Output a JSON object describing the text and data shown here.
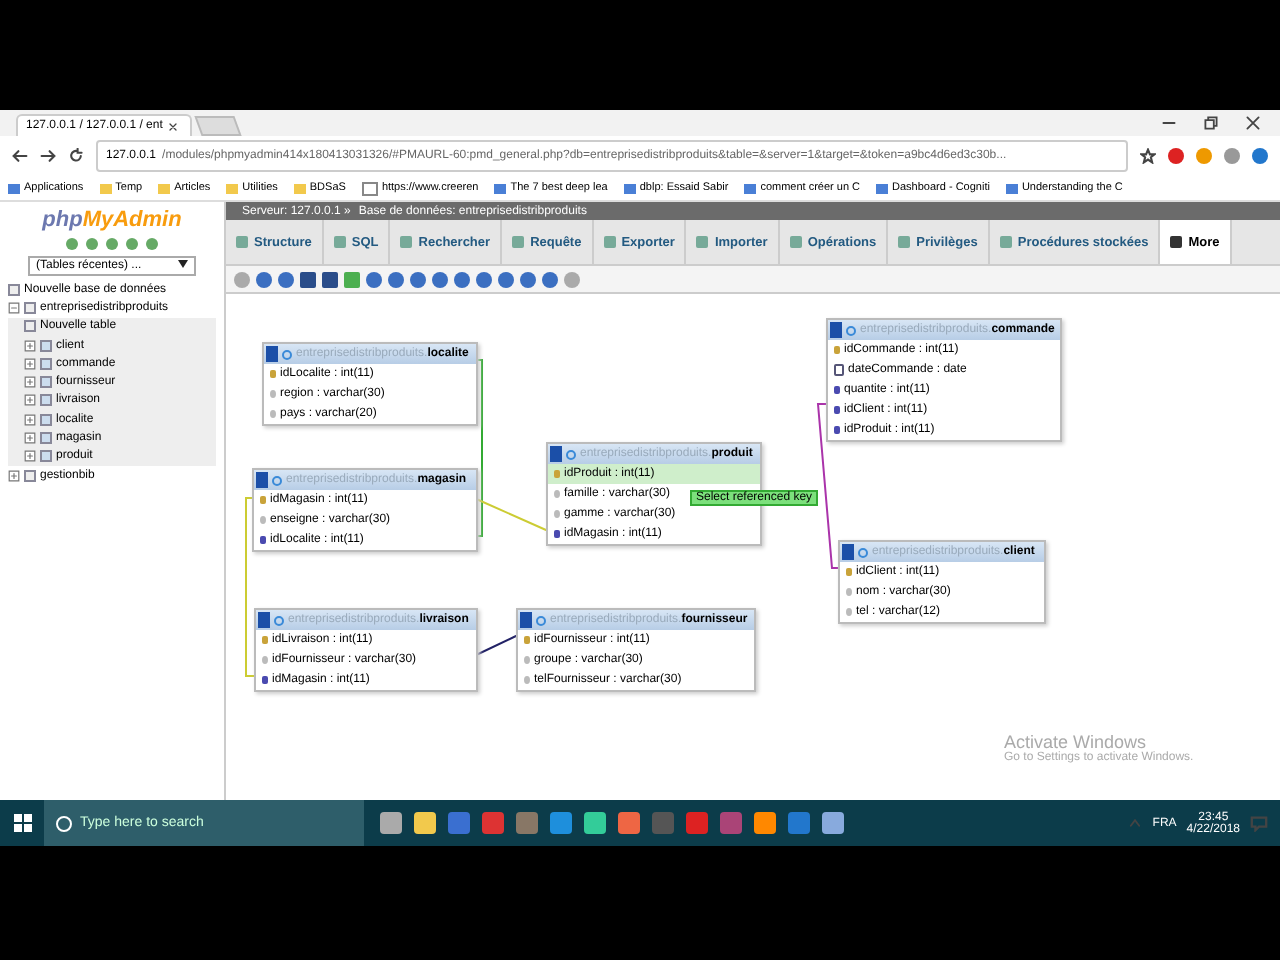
{
  "browser": {
    "tab_title": "127.0.0.1 / 127.0.0.1 / ent",
    "url_host": "127.0.0.1",
    "url_path": "/modules/phpmyadmin414x180413031326/#PMAURL-60:pmd_general.php?db=entreprisedistribproduits&table=&server=1&target=&token=a9bc4d6ed3c30b...",
    "bookmarks": [
      "Applications",
      "Temp",
      "Articles",
      "Utilities",
      "BDSaS",
      "https://www.creeren",
      "The 7 best deep lea",
      "dblp: Essaid Sabir",
      "comment créer un C",
      "Dashboard - Cogniti",
      "Understanding the C"
    ]
  },
  "sidebar": {
    "logo_php": "php",
    "logo_rest": "MyAdmin",
    "recent_select": "(Tables récentes) ...",
    "tree": [
      {
        "label": "Nouvelle base de données",
        "kind": "new"
      },
      {
        "label": "entreprisedistribproduits",
        "kind": "db",
        "expanded": true,
        "children": [
          {
            "label": "Nouvelle table",
            "kind": "new"
          },
          {
            "label": "client",
            "kind": "table"
          },
          {
            "label": "commande",
            "kind": "table"
          },
          {
            "label": "fournisseur",
            "kind": "table"
          },
          {
            "label": "livraison",
            "kind": "table"
          },
          {
            "label": "localite",
            "kind": "table"
          },
          {
            "label": "magasin",
            "kind": "table"
          },
          {
            "label": "produit",
            "kind": "table"
          }
        ]
      },
      {
        "label": "gestionbib",
        "kind": "db",
        "expanded": false
      }
    ]
  },
  "breadcrumb": {
    "server": "Serveur: 127.0.0.1 »",
    "database": "Base de données: entreprisedistribproduits"
  },
  "tabs": [
    {
      "label": "Structure",
      "selected": false
    },
    {
      "label": "SQL",
      "selected": false
    },
    {
      "label": "Rechercher",
      "selected": false
    },
    {
      "label": "Requête",
      "selected": false
    },
    {
      "label": "Exporter",
      "selected": false
    },
    {
      "label": "Importer",
      "selected": false
    },
    {
      "label": "Opérations",
      "selected": false
    },
    {
      "label": "Privilèges",
      "selected": false
    },
    {
      "label": "Procédures stockées",
      "selected": false
    },
    {
      "label": "More",
      "selected": true
    }
  ],
  "designer_tables": [
    {
      "schema": "entreprisedistribproduits.",
      "name": "localite",
      "rows": [
        {
          "text": "idLocalite : int(11)",
          "kind": "primary",
          "highlighted": false
        },
        {
          "text": "region : varchar(30)",
          "kind": "column",
          "highlighted": false
        },
        {
          "text": "pays : varchar(20)",
          "kind": "column",
          "highlighted": false
        }
      ]
    },
    {
      "schema": "entreprisedistribproduits.",
      "name": "magasin",
      "rows": [
        {
          "text": "idMagasin : int(11)",
          "kind": "primary",
          "highlighted": false
        },
        {
          "text": "enseigne : varchar(30)",
          "kind": "column",
          "highlighted": false
        },
        {
          "text": "idLocalite : int(11)",
          "kind": "foreign",
          "highlighted": false
        }
      ]
    },
    {
      "schema": "entreprisedistribproduits.",
      "name": "produit",
      "rows": [
        {
          "text": "idProduit : int(11)",
          "kind": "primary",
          "highlighted": true
        },
        {
          "text": "famille : varchar(30)",
          "kind": "column",
          "highlighted": false
        },
        {
          "text": "gamme : varchar(30)",
          "kind": "column",
          "highlighted": false
        },
        {
          "text": "idMagasin : int(11)",
          "kind": "foreign",
          "highlighted": false
        }
      ]
    },
    {
      "schema": "entreprisedistribproduits.",
      "name": "livraison",
      "rows": [
        {
          "text": "idLivraison : int(11)",
          "kind": "primary",
          "highlighted": false
        },
        {
          "text": "idFournisseur : varchar(30)",
          "kind": "column",
          "highlighted": false
        },
        {
          "text": "idMagasin : int(11)",
          "kind": "foreign",
          "highlighted": false
        }
      ]
    },
    {
      "schema": "entreprisedistribproduits.",
      "name": "fournisseur",
      "rows": [
        {
          "text": "idFournisseur : int(11)",
          "kind": "primary",
          "highlighted": false
        },
        {
          "text": "groupe : varchar(30)",
          "kind": "column",
          "highlighted": false
        },
        {
          "text": "telFournisseur : varchar(30)",
          "kind": "column",
          "highlighted": false
        }
      ]
    },
    {
      "schema": "entreprisedistribproduits.",
      "name": "commande",
      "rows": [
        {
          "text": "idCommande : int(11)",
          "kind": "primary",
          "highlighted": false
        },
        {
          "text": "dateCommande : date",
          "kind": "date",
          "highlighted": false
        },
        {
          "text": "quantite : int(11)",
          "kind": "foreign",
          "highlighted": false
        },
        {
          "text": "idClient : int(11)",
          "kind": "foreign",
          "highlighted": false
        },
        {
          "text": "idProduit : int(11)",
          "kind": "foreign",
          "highlighted": false
        }
      ]
    },
    {
      "schema": "entreprisedistribproduits.",
      "name": "client",
      "rows": [
        {
          "text": "idClient : int(11)",
          "kind": "primary",
          "highlighted": false
        },
        {
          "text": "nom : varchar(30)",
          "kind": "column",
          "highlighted": false
        },
        {
          "text": "tel : varchar(12)",
          "kind": "column",
          "highlighted": false
        }
      ]
    }
  ],
  "tooltip": "Select referenced key",
  "activation": {
    "title": "Activate Windows",
    "hint": "Go to Settings to activate Windows."
  },
  "taskbar": {
    "search_placeholder": "Type here to search",
    "language": "FRA",
    "time": "23:45",
    "date": "4/22/2018"
  }
}
